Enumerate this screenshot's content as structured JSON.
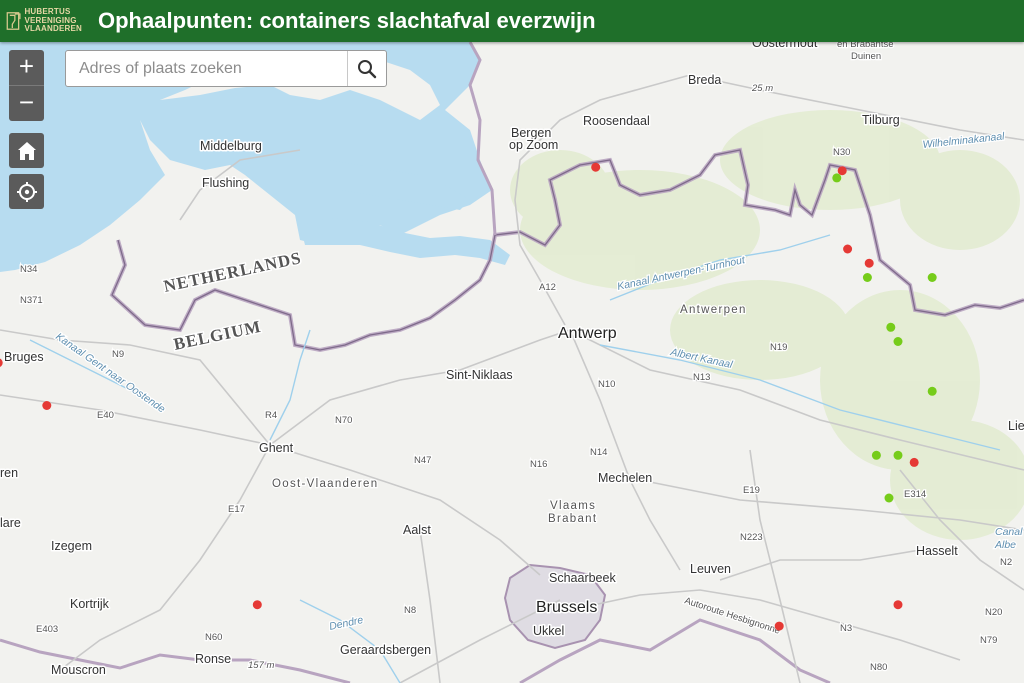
{
  "header": {
    "title": "Ophaalpunten: containers slachtafval everzwijn",
    "logo_lines": [
      "HUBERTUS",
      "VERENIGING",
      "VLAANDEREN"
    ]
  },
  "controls": {
    "zoom_in": "+",
    "zoom_out": "−",
    "home_icon": "home-icon",
    "locate_icon": "locate-icon"
  },
  "search": {
    "placeholder": "Adres of plaats zoeken",
    "value": "",
    "button_icon": "search-icon"
  },
  "colors": {
    "header": "#1f6f2a",
    "water": "#b7dcf0",
    "land": "#f2f2ef",
    "border": "#9b86a4",
    "marker_red": "#e53935",
    "marker_green": "#76cc1a"
  },
  "map": {
    "cities": [
      "Oostermout",
      "Breda",
      "Tilburg",
      "Roosendaal",
      "Bergen op Zoom",
      "Middelburg",
      "Flushing",
      "Antwerp",
      "Sint-Niklaas",
      "Bruges",
      "Ghent",
      "Mechelen",
      "Aalst",
      "Izegem",
      "Kortrijk",
      "Schaarbeek",
      "Brussels",
      "Ukkel",
      "Leuven",
      "Hasselt",
      "Ronse",
      "Geraardsbergen",
      "Mouscron",
      "Lier",
      "lare"
    ],
    "regions": [
      "Antwerpen",
      "Oost-Vlaanderen",
      "Vlaams Brabant"
    ],
    "countries": [
      "NETHERLANDS",
      "BELGIUM"
    ],
    "parks": [
      "en Brabantse Duinen"
    ],
    "waterways": [
      "Kanaal Antwerpen-Turnhout",
      "Albert Kanaal",
      "Wilhelminakanaal",
      "Dendre",
      "Kanaal Gent naar Oostende",
      "Canal",
      "Albe"
    ],
    "roads": [
      "N34",
      "N371",
      "N9",
      "E40",
      "R4",
      "N70",
      "N47",
      "N16",
      "N14",
      "N10",
      "N13",
      "N19",
      "E314",
      "N2",
      "A12",
      "N30",
      "E17",
      "N60",
      "E403",
      "N8",
      "N223",
      "E19",
      "N3",
      "N20",
      "N79",
      "N80",
      "Autoroute Hesbignonne"
    ],
    "elevations": [
      "25 m",
      "157 m"
    ],
    "markers": [
      {
        "type": "red",
        "lat": 51.425,
        "lon": 4.38
      },
      {
        "type": "red",
        "lat": 51.42,
        "lon": 5.065
      },
      {
        "type": "green",
        "lat": 51.41,
        "lon": 5.05
      },
      {
        "type": "red",
        "lat": 51.31,
        "lon": 5.08
      },
      {
        "type": "red",
        "lat": 51.29,
        "lon": 5.14
      },
      {
        "type": "green",
        "lat": 51.27,
        "lon": 5.135
      },
      {
        "type": "green",
        "lat": 51.27,
        "lon": 5.315
      },
      {
        "type": "green",
        "lat": 51.2,
        "lon": 5.2
      },
      {
        "type": "green",
        "lat": 51.18,
        "lon": 5.22
      },
      {
        "type": "red",
        "lat": 51.15,
        "lon": 2.72
      },
      {
        "type": "red",
        "lat": 51.09,
        "lon": 2.855
      },
      {
        "type": "green",
        "lat": 51.11,
        "lon": 5.315
      },
      {
        "type": "green",
        "lat": 51.02,
        "lon": 5.16
      },
      {
        "type": "green",
        "lat": 51.02,
        "lon": 5.22
      },
      {
        "type": "red",
        "lat": 51.01,
        "lon": 5.265
      },
      {
        "type": "green",
        "lat": 50.96,
        "lon": 5.195
      },
      {
        "type": "red",
        "lat": 50.81,
        "lon": 3.44
      },
      {
        "type": "red",
        "lat": 50.81,
        "lon": 5.22
      },
      {
        "type": "red",
        "lat": 50.78,
        "lon": 4.89
      }
    ]
  }
}
